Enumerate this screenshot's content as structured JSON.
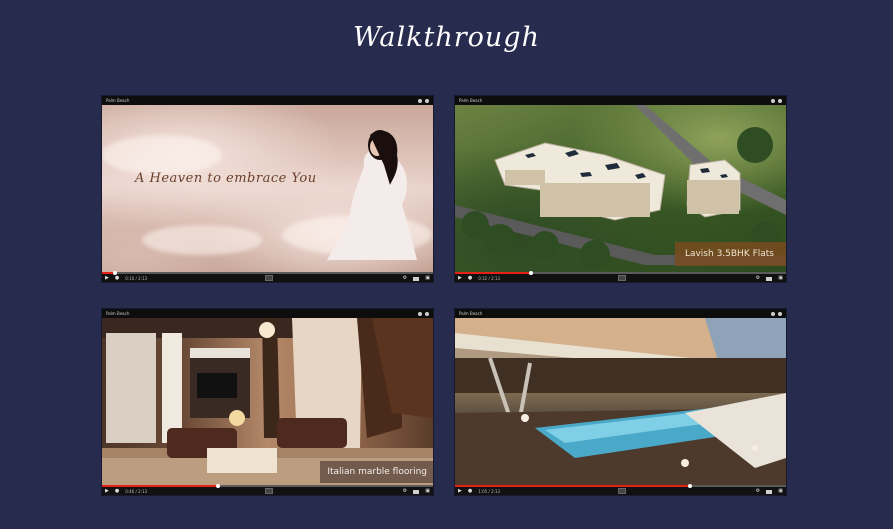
{
  "section": {
    "title": "Walkthrough"
  },
  "videos": [
    {
      "channel": "Palm Beach",
      "time": "0:10 / 2:13",
      "progress": 0.04,
      "caption": "A Heaven to embrace You"
    },
    {
      "channel": "Palm Beach",
      "time": "0:32 / 2:13",
      "progress": 0.23,
      "caption": "Lavish 3.5BHK Flats"
    },
    {
      "channel": "Palm Beach",
      "time": "0:46 / 2:13",
      "progress": 0.35,
      "caption": "Italian marble flooring"
    },
    {
      "channel": "Palm Beach",
      "time": "1:05 / 2:13",
      "progress": 0.71,
      "caption": ""
    }
  ],
  "colors": {
    "background": "#272b4d",
    "progress": "#e62117"
  }
}
